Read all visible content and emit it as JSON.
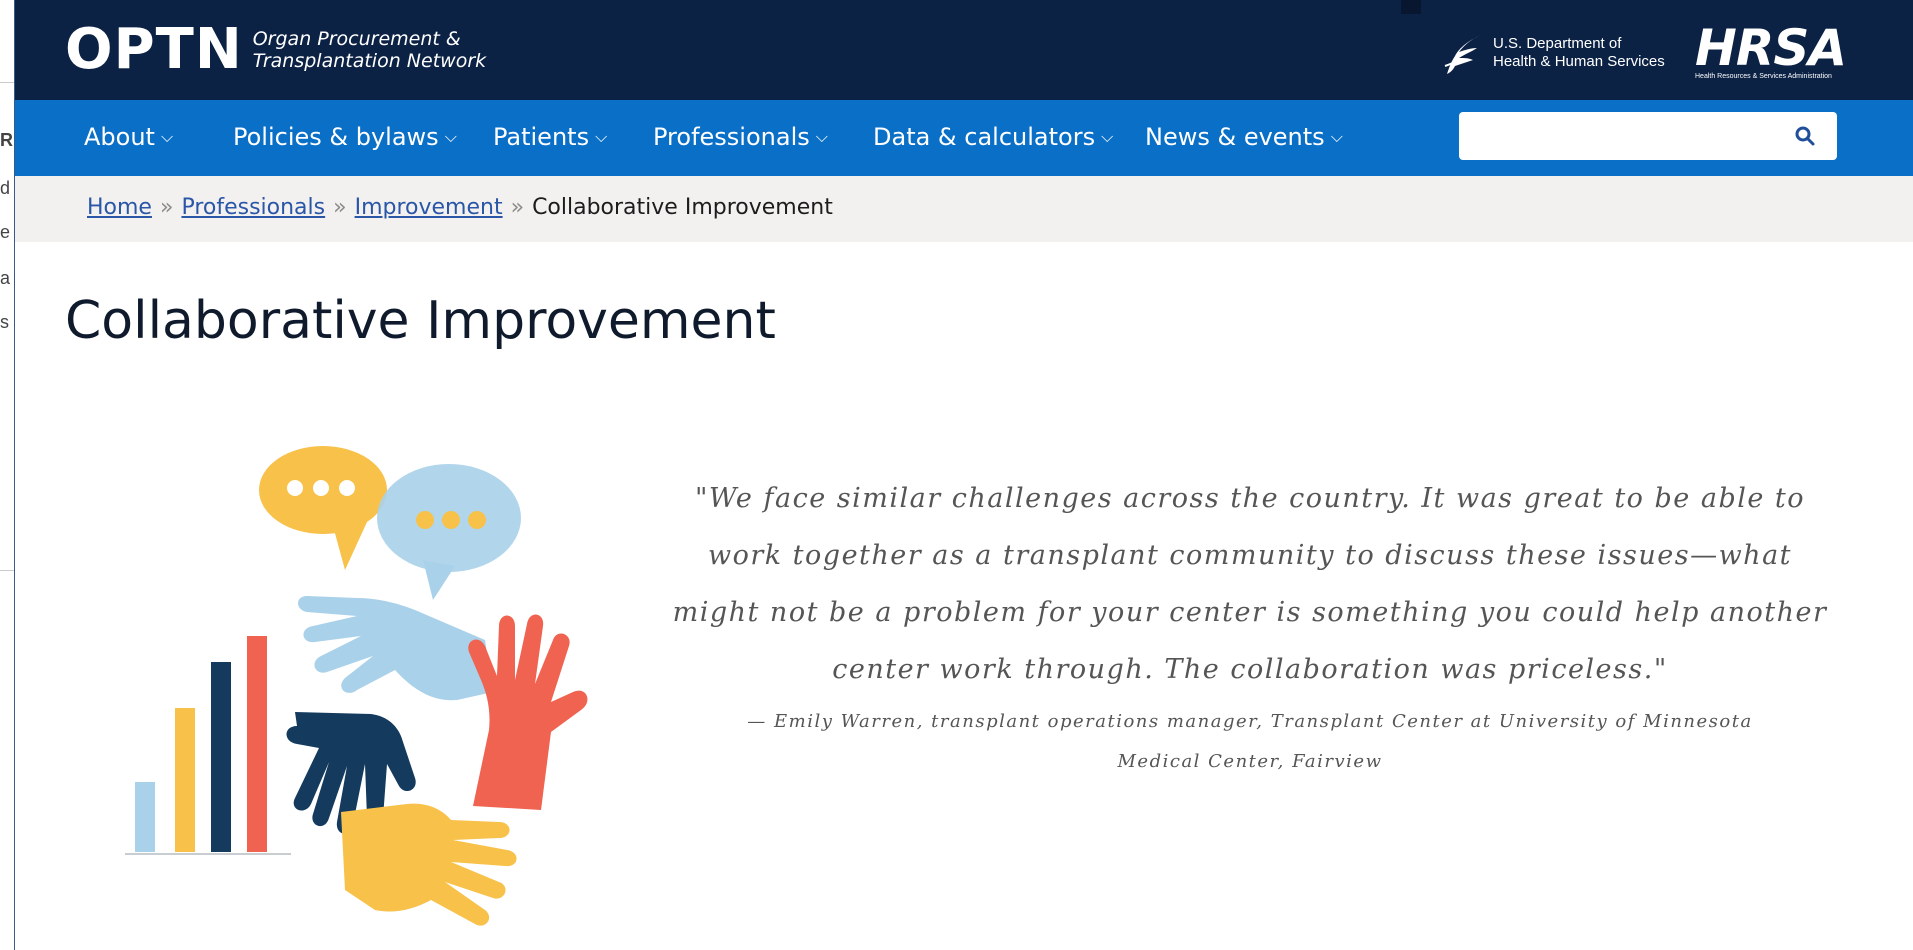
{
  "background_fragments": [
    "R",
    "d",
    "e",
    "a",
    "s"
  ],
  "header": {
    "logo_mark": "OPTN",
    "logo_line1": "Organ Procurement &",
    "logo_line2": "Transplantation Network",
    "hhs_line1": "U.S. Department of",
    "hhs_line2": "Health & Human Services",
    "hrsa_mark": "HRSA",
    "hrsa_sub": "Health Resources & Services Administration"
  },
  "nav": {
    "items": [
      {
        "label": "About",
        "icon": "chevron-down-icon"
      },
      {
        "label": "Policies & bylaws",
        "icon": "chevron-down-icon"
      },
      {
        "label": "Patients",
        "icon": "chevron-down-icon"
      },
      {
        "label": "Professionals",
        "icon": "chevron-down-icon"
      },
      {
        "label": "Data & calculators",
        "icon": "chevron-down-icon"
      },
      {
        "label": "News & events",
        "icon": "chevron-down-icon"
      }
    ],
    "search": {
      "value": "",
      "placeholder": "",
      "icon": "search-icon"
    }
  },
  "breadcrumb": {
    "items": [
      "Home",
      "Professionals",
      "Improvement"
    ],
    "current": "Collaborative Improvement",
    "separator": "»"
  },
  "page": {
    "title": "Collaborative Improvement",
    "quote": "\"We face similar challenges across the country. It was great to be able to work together as a transplant community to discuss these issues—what might not be a problem for your center is something you could help another center work through. The collaboration was priceless.\"",
    "attribution": "— Emily Warren, transplant operations manager, Transplant Center at University of Minnesota Medical Center, Fairview"
  },
  "colors": {
    "header_bg": "#0b2245",
    "nav_bg": "#0a6fc7",
    "link": "#2a56a8",
    "illus_yellow": "#f7c14a",
    "illus_lightblue": "#a9d1ea",
    "illus_navy": "#143a5e",
    "illus_red": "#ef6350"
  }
}
